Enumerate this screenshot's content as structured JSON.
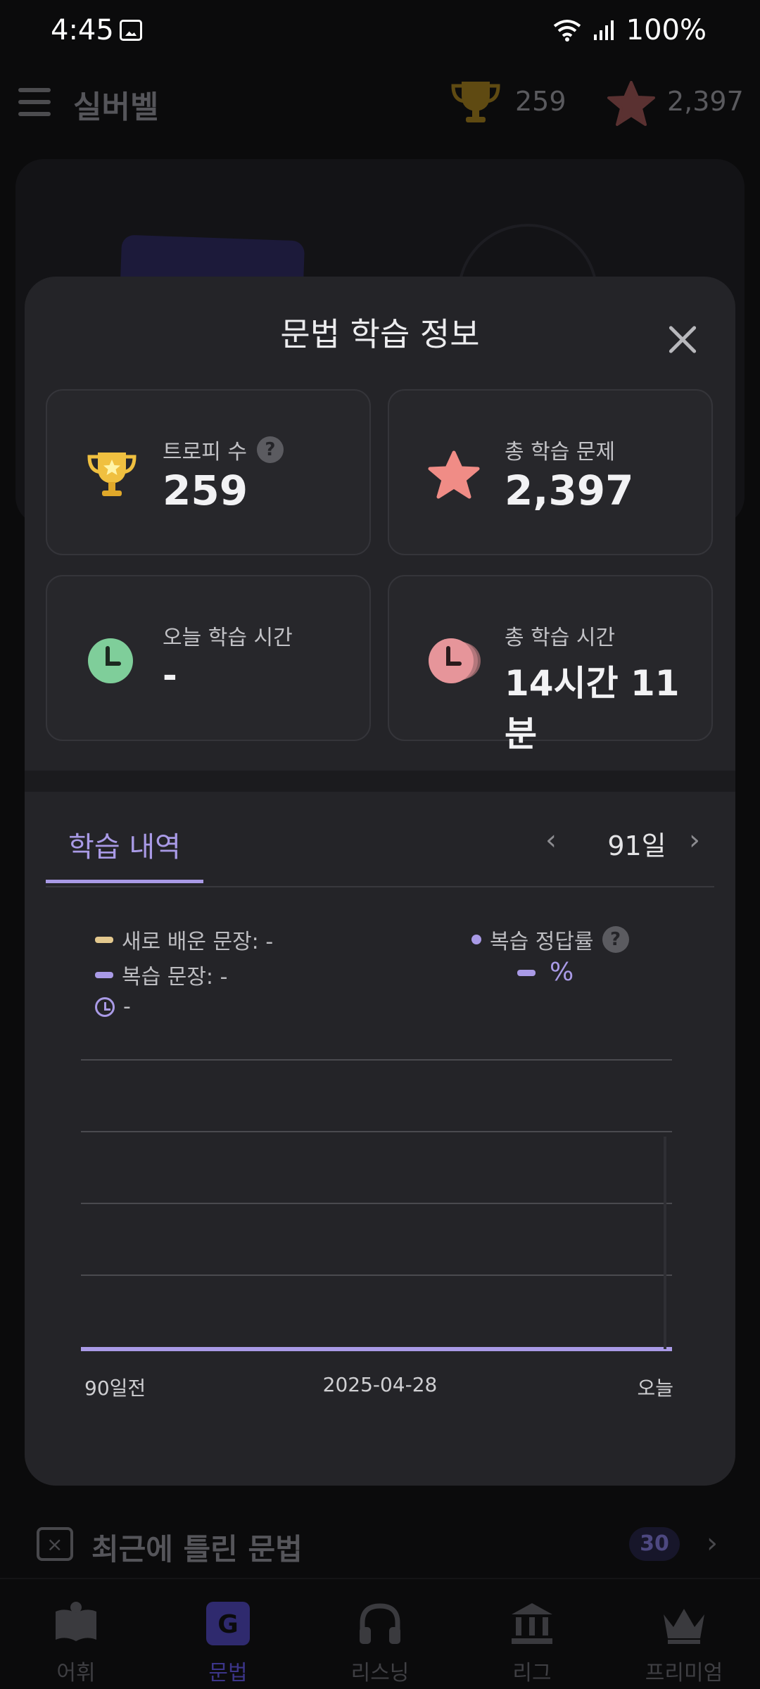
{
  "status_bar": {
    "time": "4:45",
    "battery": "100%"
  },
  "app": {
    "title": "실버벨",
    "trophies": "259",
    "stars": "2,397"
  },
  "modal": {
    "title": "문법 학습 정보",
    "stats": {
      "trophy_label": "트로피 수",
      "trophy_value": "259",
      "total_problems_label": "총 학습 문제",
      "total_problems_value": "2,397",
      "today_time_label": "오늘 학습 시간",
      "today_time_value": "-",
      "total_time_label": "총 학습 시간",
      "total_time_value": "14시간 11분"
    },
    "history": {
      "tab_label": "학습 내역",
      "period": "91일",
      "legend": {
        "new_sentences": "새로 배운 문장: -",
        "review_sentences": "복습 문장: -",
        "time": "-",
        "accuracy_label": "복습 정답률",
        "accuracy_unit": "%"
      },
      "colors": {
        "new": "#e3c88e",
        "review": "#a99ae6",
        "grid": "#4a4a4f"
      }
    }
  },
  "chart_data": {
    "type": "bar",
    "x_labels": [
      "90일전",
      "2025-04-28",
      "오늘"
    ],
    "series": [
      {
        "name": "새로 배운 문장",
        "values": []
      },
      {
        "name": "복습 문장",
        "values": []
      }
    ],
    "grid": true
  },
  "background": {
    "recent_wrong_title": "최근에 틀린 문법",
    "recent_wrong_count": "30"
  },
  "nav": [
    {
      "label": "어휘",
      "icon": "book-icon"
    },
    {
      "label": "문법",
      "icon": "grammar-icon"
    },
    {
      "label": "리스닝",
      "icon": "headphones-icon"
    },
    {
      "label": "리그",
      "icon": "league-icon"
    },
    {
      "label": "프리미엄",
      "icon": "crown-icon"
    }
  ]
}
